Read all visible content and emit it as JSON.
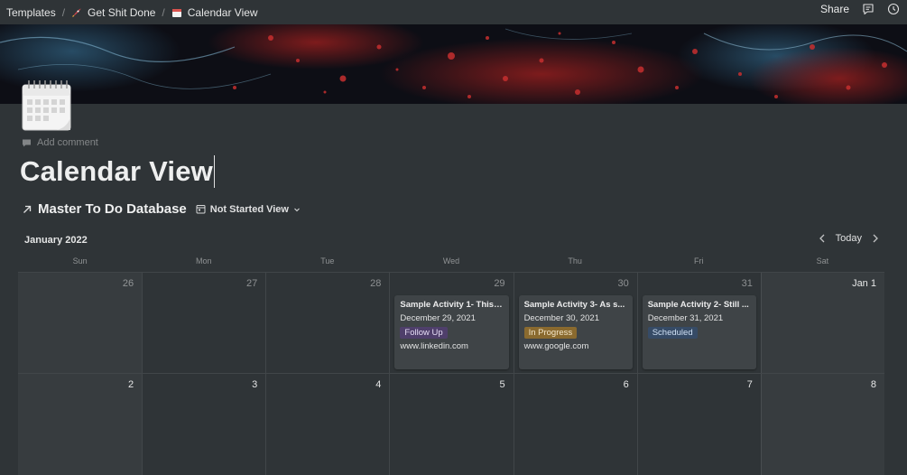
{
  "breadcrumb": [
    {
      "label": "Templates",
      "icon": ""
    },
    {
      "label": "Get Shit Done",
      "icon": "rocket-icon"
    },
    {
      "label": "Calendar View",
      "icon": "calendar-icon"
    }
  ],
  "topbar": {
    "share_label": "Share",
    "comment_icon": "comment-icon",
    "updates_icon": "clock-icon"
  },
  "page": {
    "add_comment": "Add comment",
    "title": "Calendar View"
  },
  "database": {
    "title": "Master To Do Database",
    "view_label": "Not Started View"
  },
  "calendar": {
    "month_label": "January 2022",
    "today_label": "Today",
    "days_of_week": [
      "Sun",
      "Mon",
      "Tue",
      "Wed",
      "Thu",
      "Fri",
      "Sat"
    ],
    "weeks": [
      [
        {
          "day": "26",
          "current": false
        },
        {
          "day": "27",
          "current": false
        },
        {
          "day": "28",
          "current": false
        },
        {
          "day": "29",
          "current": false
        },
        {
          "day": "30",
          "current": false
        },
        {
          "day": "31",
          "current": false
        },
        {
          "day": "Jan 1",
          "current": true
        }
      ],
      [
        {
          "day": "2",
          "current": true
        },
        {
          "day": "3",
          "current": true
        },
        {
          "day": "4",
          "current": true
        },
        {
          "day": "5",
          "current": true
        },
        {
          "day": "6",
          "current": true
        },
        {
          "day": "7",
          "current": true
        },
        {
          "day": "8",
          "current": true
        }
      ]
    ],
    "cards": [
      {
        "col": 3,
        "title": "Sample Activity 1- This i...",
        "date": "December 29, 2021",
        "tag": "Follow Up",
        "tag_bg": "#4f3f6b",
        "tag_color": "#e6dcf5",
        "url": "www.linkedin.com"
      },
      {
        "col": 4,
        "title": "Sample Activity 3- As s...",
        "date": "December 30, 2021",
        "tag": "In Progress",
        "tag_bg": "#8a6a2f",
        "tag_color": "#f3e6c9",
        "url": "www.google.com"
      },
      {
        "col": 5,
        "title": "Sample Activity 2- Still ...",
        "date": "December 31, 2021",
        "tag": "Scheduled",
        "tag_bg": "#364b66",
        "tag_color": "#cfe0f5",
        "url": ""
      }
    ]
  }
}
